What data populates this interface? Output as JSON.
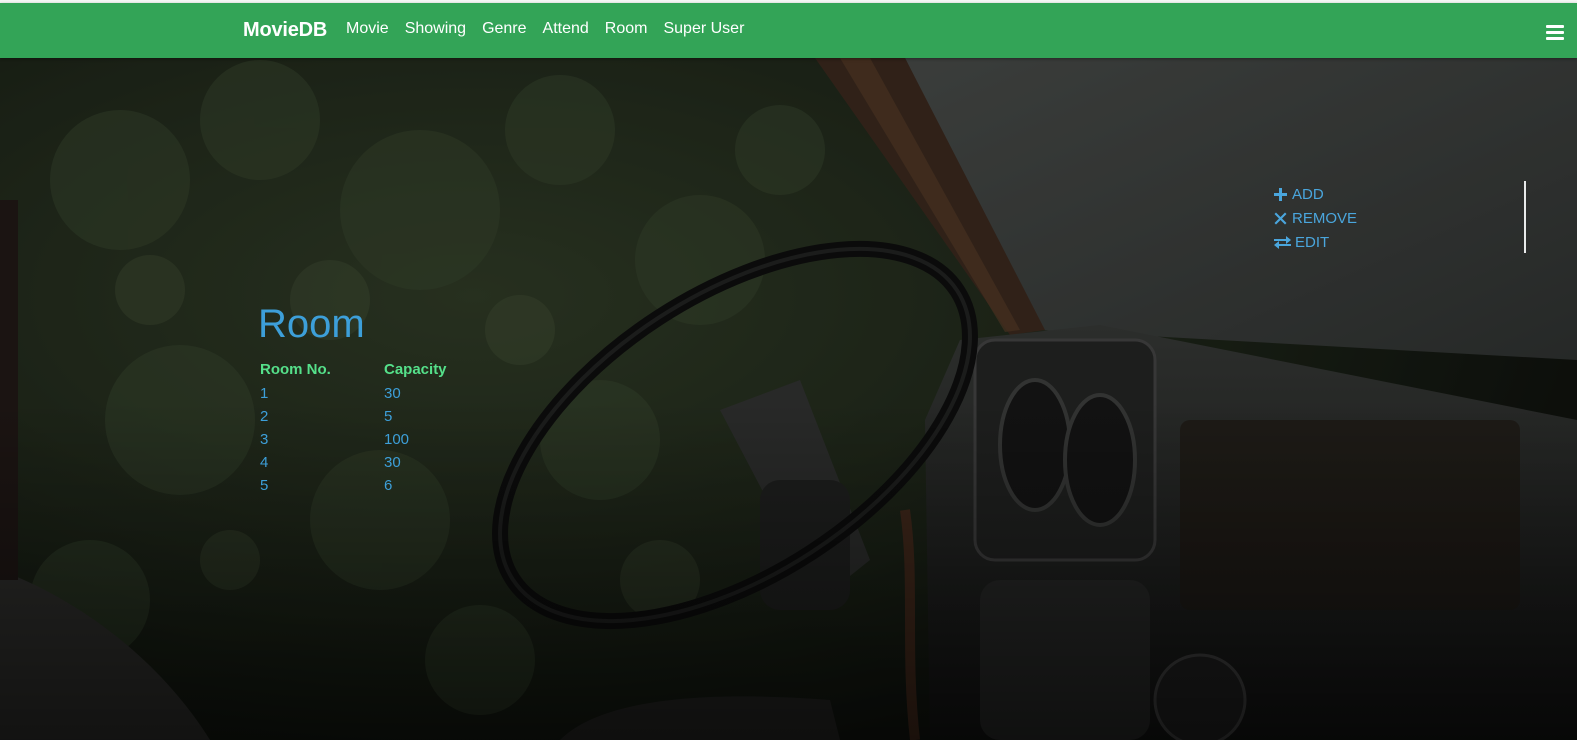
{
  "navbar": {
    "brand": "MovieDB",
    "links": [
      "Movie",
      "Showing",
      "Genre",
      "Attend",
      "Room",
      "Super User"
    ]
  },
  "actions": {
    "add": "ADD",
    "remove": "REMOVE",
    "edit": "EDIT"
  },
  "page": {
    "title": "Room"
  },
  "table": {
    "headers": [
      "Room No.",
      "Capacity"
    ],
    "rows": [
      [
        "1",
        "30"
      ],
      [
        "2",
        "5"
      ],
      [
        "3",
        "100"
      ],
      [
        "4",
        "30"
      ],
      [
        "5",
        "6"
      ]
    ]
  },
  "colors": {
    "navbar": "#33a457",
    "link": "#3d9fd9",
    "header": "#55e08a"
  }
}
